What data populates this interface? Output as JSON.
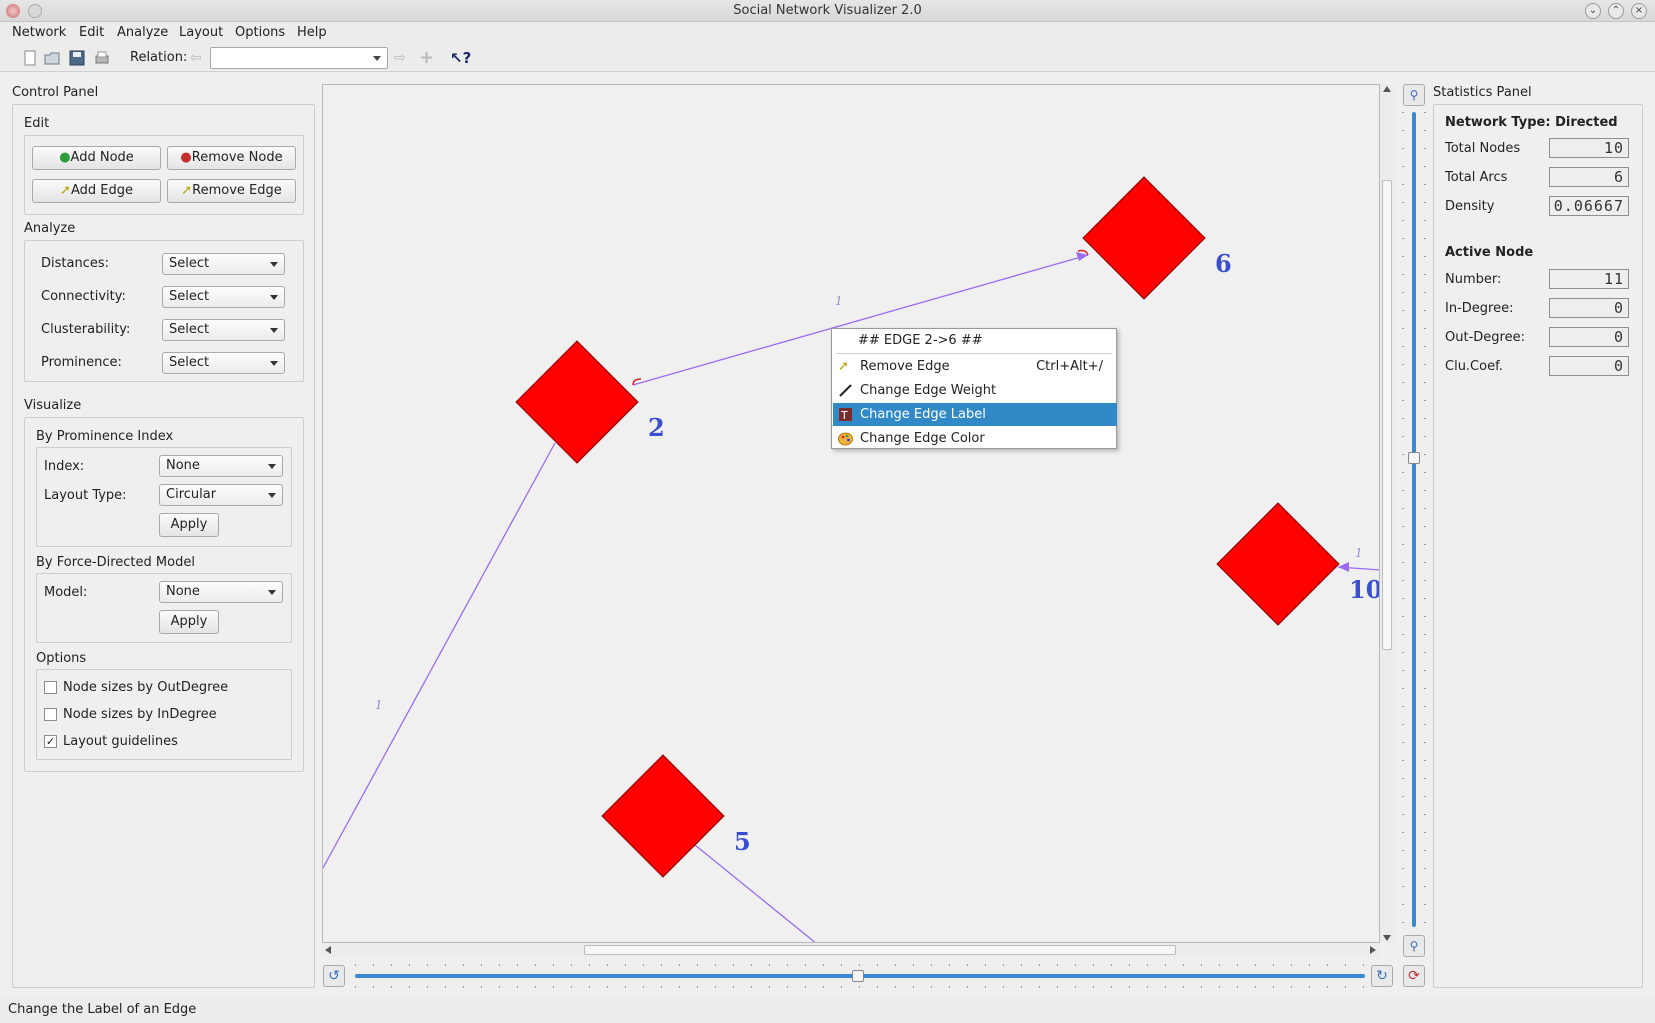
{
  "window": {
    "title": "Social Network Visualizer 2.0"
  },
  "menu": [
    "Network",
    "Edit",
    "Analyze",
    "Layout",
    "Options",
    "Help"
  ],
  "toolbar": {
    "relation_label": "Relation:",
    "relation_value": ""
  },
  "control_panel": {
    "title": "Control Panel",
    "edit": {
      "title": "Edit",
      "add_node": "Add Node",
      "remove_node": "Remove Node",
      "add_edge": "Add Edge",
      "remove_edge": "Remove Edge"
    },
    "analyze": {
      "title": "Analyze",
      "rows": [
        {
          "label": "Distances:",
          "value": "Select"
        },
        {
          "label": "Connectivity:",
          "value": "Select"
        },
        {
          "label": "Clusterability:",
          "value": "Select"
        },
        {
          "label": "Prominence:",
          "value": "Select"
        }
      ]
    },
    "visualize": {
      "title": "Visualize",
      "prominence": {
        "title": "By Prominence Index",
        "index_label": "Index:",
        "index_value": "None",
        "layout_label": "Layout Type:",
        "layout_value": "Circular",
        "apply": "Apply"
      },
      "force": {
        "title": "By Force-Directed Model",
        "model_label": "Model:",
        "model_value": "None",
        "apply": "Apply"
      },
      "options": {
        "title": "Options",
        "items": [
          {
            "label": "Node sizes by OutDegree",
            "checked": false
          },
          {
            "label": "Node sizes by InDegree",
            "checked": false
          },
          {
            "label": "Layout guidelines",
            "checked": true
          }
        ]
      }
    }
  },
  "graph": {
    "nodes": [
      {
        "id": "2",
        "label": "2",
        "color": "#ff0000"
      },
      {
        "id": "6",
        "label": "6",
        "color": "#ff0000"
      },
      {
        "id": "10",
        "label": "10",
        "color": "#ff0000"
      },
      {
        "id": "5",
        "label": "5",
        "color": "#ff0000"
      }
    ],
    "edge_weights": [
      "1",
      "1",
      "1"
    ],
    "edge_color": "#9966ff",
    "label_color": "#3a4fd0"
  },
  "context_menu": {
    "header": "## EDGE 2->6 ##",
    "items": [
      {
        "label": "Remove Edge",
        "shortcut": "Ctrl+Alt+/",
        "icon": "remove-edge-icon"
      },
      {
        "label": "Change Edge Weight",
        "shortcut": "",
        "icon": "edge-weight-icon"
      },
      {
        "label": "Change Edge Label",
        "shortcut": "",
        "icon": "edge-label-icon",
        "highlighted": true
      },
      {
        "label": "Change Edge Color",
        "shortcut": "",
        "icon": "palette-icon"
      }
    ]
  },
  "statistics": {
    "title": "Statistics Panel",
    "network_type": "Network Type: Directed",
    "total_nodes_label": "Total Nodes",
    "total_nodes": "10",
    "total_arcs_label": "Total Arcs",
    "total_arcs": "6",
    "density_label": "Density",
    "density": "0.06667",
    "active_node_title": "Active Node",
    "number_label": "Number:",
    "number": "11",
    "indegree_label": "In-Degree:",
    "indegree": "0",
    "outdegree_label": "Out-Degree:",
    "outdegree": "0",
    "clucoef_label": "Clu.Coef.",
    "clucoef": "0"
  },
  "status": {
    "text": "Change the Label of an Edge"
  }
}
